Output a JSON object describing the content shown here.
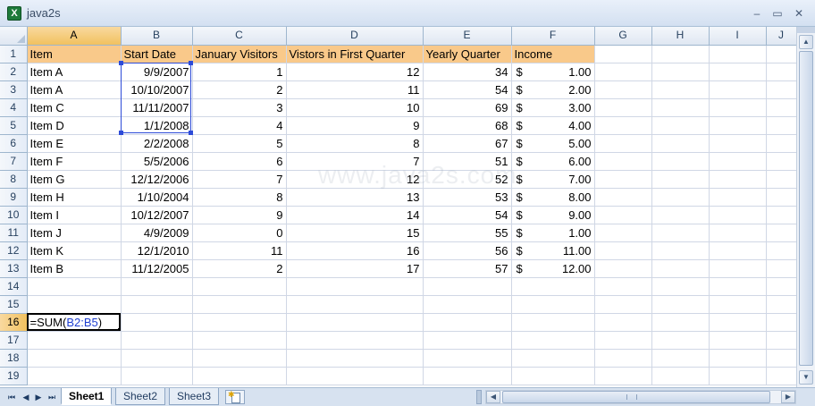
{
  "window": {
    "title": "java2s",
    "app_icon_glyph": "X",
    "minimize_glyph": "–",
    "restore_glyph": "▭",
    "close_glyph": "✕"
  },
  "columns": [
    "A",
    "B",
    "C",
    "D",
    "E",
    "F",
    "G",
    "H",
    "I",
    "J"
  ],
  "row_numbers": [
    "1",
    "2",
    "3",
    "4",
    "5",
    "6",
    "7",
    "8",
    "9",
    "10",
    "11",
    "12",
    "13",
    "14",
    "15",
    "16",
    "17",
    "18",
    "19"
  ],
  "headers": [
    "Item",
    "Start Date",
    "January Visitors",
    "Vistors in First Quarter",
    "Yearly Quarter",
    "Income"
  ],
  "rows": [
    {
      "item": "Item A",
      "date": "9/9/2007",
      "jan": "1",
      "q1": "12",
      "yearly": "34",
      "cur": "$",
      "income": "1.00"
    },
    {
      "item": "Item A",
      "date": "10/10/2007",
      "jan": "2",
      "q1": "11",
      "yearly": "54",
      "cur": "$",
      "income": "2.00"
    },
    {
      "item": "Item C",
      "date": "11/11/2007",
      "jan": "3",
      "q1": "10",
      "yearly": "69",
      "cur": "$",
      "income": "3.00"
    },
    {
      "item": "Item D",
      "date": "1/1/2008",
      "jan": "4",
      "q1": "9",
      "yearly": "68",
      "cur": "$",
      "income": "4.00"
    },
    {
      "item": "Item E",
      "date": "2/2/2008",
      "jan": "5",
      "q1": "8",
      "yearly": "67",
      "cur": "$",
      "income": "5.00"
    },
    {
      "item": "Item F",
      "date": "5/5/2006",
      "jan": "6",
      "q1": "7",
      "yearly": "51",
      "cur": "$",
      "income": "6.00"
    },
    {
      "item": "Item G",
      "date": "12/12/2006",
      "jan": "7",
      "q1": "12",
      "yearly": "52",
      "cur": "$",
      "income": "7.00"
    },
    {
      "item": "Item H",
      "date": "1/10/2004",
      "jan": "8",
      "q1": "13",
      "yearly": "53",
      "cur": "$",
      "income": "8.00"
    },
    {
      "item": "Item I",
      "date": "10/12/2007",
      "jan": "9",
      "q1": "14",
      "yearly": "54",
      "cur": "$",
      "income": "9.00"
    },
    {
      "item": "Item J",
      "date": "4/9/2009",
      "jan": "0",
      "q1": "15",
      "yearly": "55",
      "cur": "$",
      "income": "1.00"
    },
    {
      "item": "Item K",
      "date": "12/1/2010",
      "jan": "11",
      "q1": "16",
      "yearly": "56",
      "cur": "$",
      "income": "11.00"
    },
    {
      "item": "Item B",
      "date": "11/12/2005",
      "jan": "2",
      "q1": "17",
      "yearly": "57",
      "cur": "$",
      "income": "12.00"
    }
  ],
  "active_cell": {
    "address": "A16",
    "formula_prefix": "=SUM(",
    "formula_ref": "B2:B5",
    "formula_suffix": ")"
  },
  "highlight_range": "B2:B5",
  "watermark": "www.java2s.com",
  "sheets": [
    {
      "label": "Sheet1",
      "active": true
    },
    {
      "label": "Sheet2",
      "active": false
    },
    {
      "label": "Sheet3",
      "active": false
    }
  ],
  "sheet_nav": {
    "first": "⏮",
    "prev": "◀",
    "next": "▶",
    "last": "⏭"
  },
  "colors": {
    "header_fill": "#f9c98a",
    "selected_heading": "#f1c15f",
    "range_border": "#2d4bd8",
    "formula_ref": "#1f3fd1"
  }
}
